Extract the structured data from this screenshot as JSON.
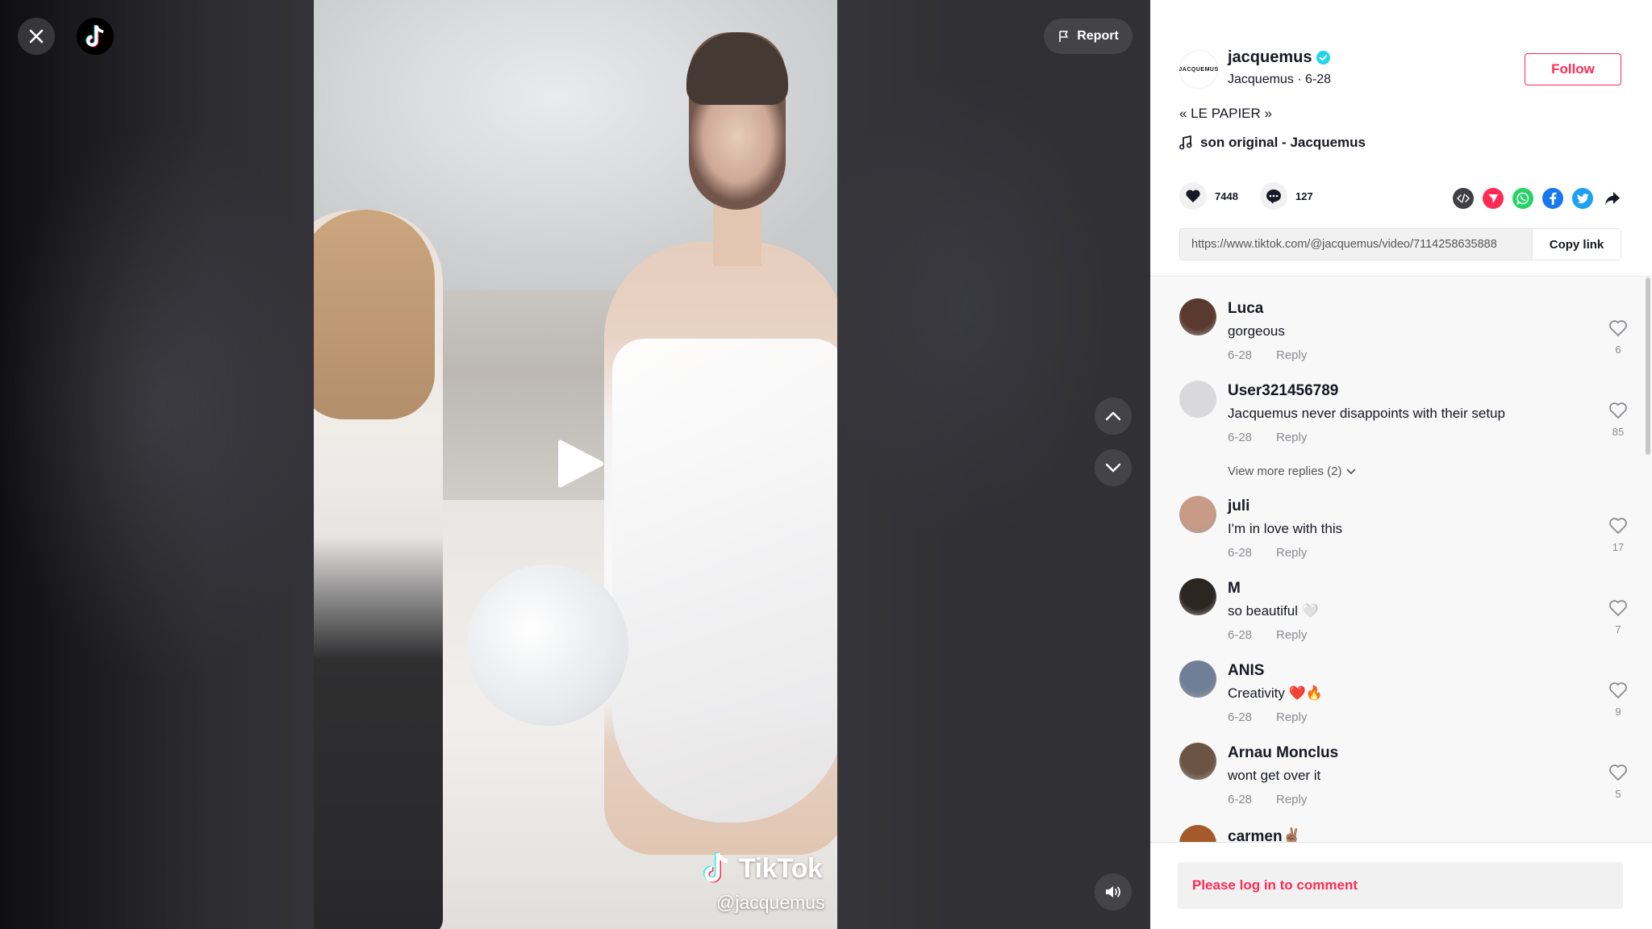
{
  "top": {
    "report_label": "Report"
  },
  "video": {
    "watermark_brand": "TikTok",
    "watermark_user": "@jacquemus"
  },
  "author": {
    "avatar_text": "JACQUEMUS",
    "username": "jacquemus",
    "subtitle": "Jacquemus · 6-28",
    "follow_label": "Follow",
    "caption": "« LE PAPIER »",
    "music": "son original - Jacquemus"
  },
  "stats": {
    "likes": "7448",
    "comments": "127"
  },
  "share": {
    "icons": [
      "embed-icon",
      "send-to-friends-icon",
      "whatsapp-icon",
      "facebook-icon",
      "twitter-icon",
      "share-arrow-icon"
    ],
    "colors": {
      "embed": "#3f3f44",
      "send": "#fe2c55",
      "whatsapp": "#25d366",
      "facebook": "#1877f2",
      "twitter": "#1da1f2"
    }
  },
  "link": {
    "url": "https://www.tiktok.com/@jacquemus/video/7114258635888",
    "copy_label": "Copy link"
  },
  "comments": [
    {
      "user": "Luca",
      "text": "gorgeous",
      "date": "6-28",
      "reply": "Reply",
      "likes": "6",
      "avatar_color": "#5a3a2e"
    },
    {
      "user": "User321456789",
      "text": "Jacquemus never disappoints with their setup",
      "date": "6-28",
      "reply": "Reply",
      "likes": "85",
      "avatar_color": "#d9d9dc"
    },
    {
      "user": "juli",
      "text": "I'm in love with this",
      "date": "6-28",
      "reply": "Reply",
      "likes": "17",
      "avatar_color": "#c79b86"
    },
    {
      "user": "M",
      "text": "so beautiful 🤍",
      "date": "6-28",
      "reply": "Reply",
      "likes": "7",
      "avatar_color": "#2c2623"
    },
    {
      "user": "ANIS",
      "text": "Creativity ❤️🔥",
      "date": "6-28",
      "reply": "Reply",
      "likes": "9",
      "avatar_color": "#6f7f96"
    },
    {
      "user": "Arnau Monclus",
      "text": "wont get over it",
      "date": "6-28",
      "reply": "Reply",
      "likes": "5",
      "avatar_color": "#6b5444"
    },
    {
      "user": "carmen✌🏽",
      "text": "",
      "date": "",
      "reply": "",
      "likes": "",
      "avatar_color": "#a55a2a"
    }
  ],
  "more_replies": "View more replies (2)",
  "comment_input": {
    "placeholder": "Please log in to comment"
  },
  "colors": {
    "accent": "#fe2c55",
    "panel_bg": "#ffffff",
    "comments_bg": "#f8f8f8",
    "verified": "#20d5ec"
  }
}
